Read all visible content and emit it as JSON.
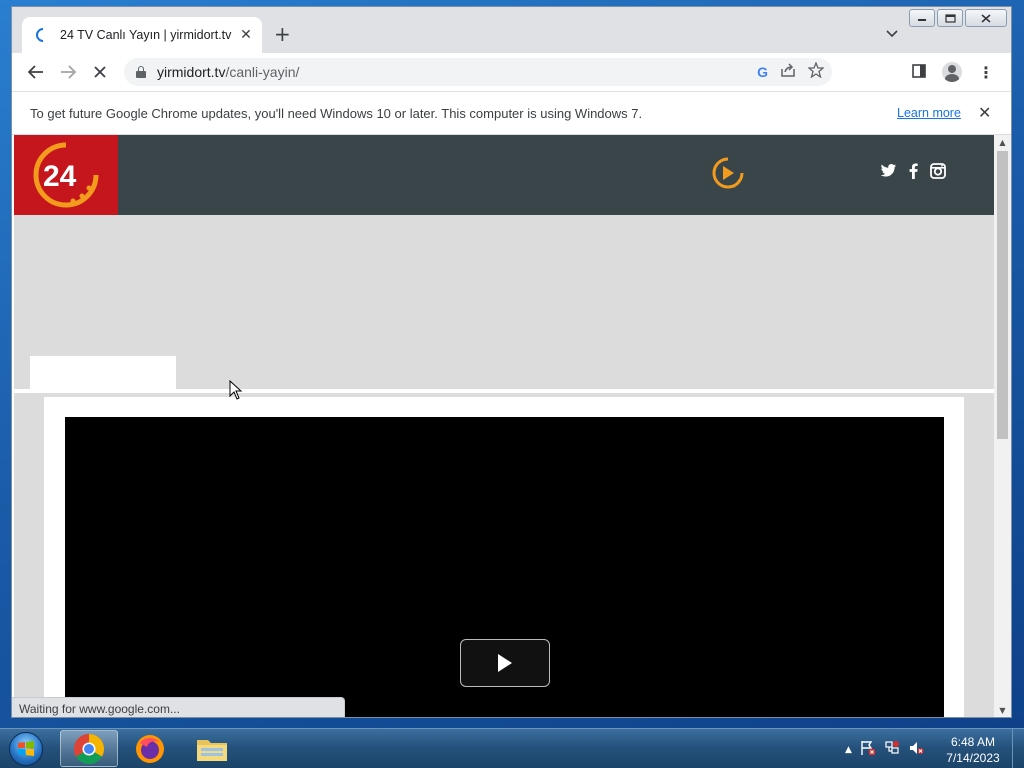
{
  "tab": {
    "title": "24 TV Canlı Yayın | yirmidort.tv",
    "close": "✕",
    "new_tab": "+"
  },
  "window_controls": {
    "minimize": "—",
    "maximize": "□",
    "close": "✕"
  },
  "toolbar": {
    "back": "←",
    "forward": "→",
    "stop": "✕",
    "url_host": "yirmidort.tv",
    "url_path": "/canli-yayin/",
    "menu": "⋮"
  },
  "infobar": {
    "message": "To get future Google Chrome updates, you'll need Windows 10 or later. This computer is using Windows 7.",
    "link": "Learn more",
    "close": "✕"
  },
  "site": {
    "logo_text": "24",
    "colors": {
      "header": "#3a4549",
      "logo_bg": "#c4161c",
      "accent": "#f29b1d"
    }
  },
  "status": {
    "text": "Waiting for www.google.com..."
  },
  "clock": {
    "time": "6:48 AM",
    "date": "7/14/2023"
  },
  "taskbar": {
    "apps": [
      "Google Chrome",
      "Mozilla Firefox",
      "Windows Explorer"
    ]
  },
  "icons": {
    "tab_favicon": "loading-spinner",
    "social": [
      "twitter-icon",
      "facebook-icon",
      "instagram-icon"
    ],
    "live": "live-play-icon"
  }
}
